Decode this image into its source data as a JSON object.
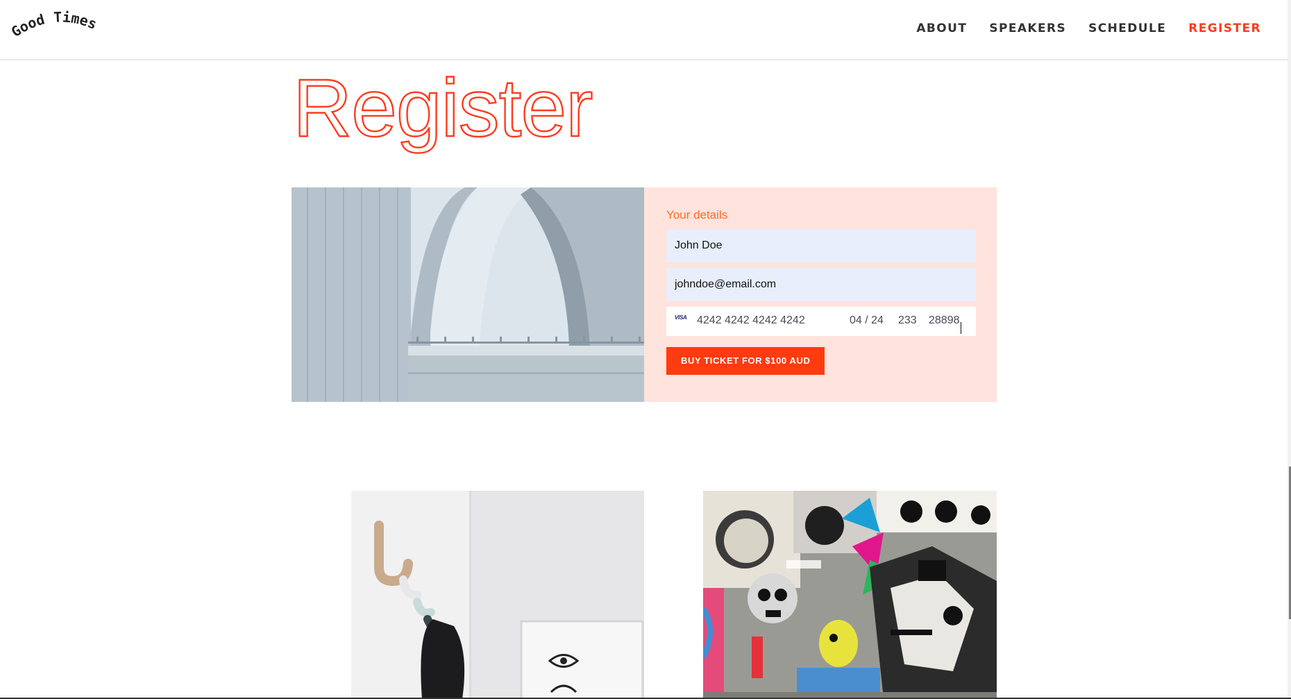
{
  "header": {
    "logo_text": "Good Times",
    "nav": [
      {
        "label": "ABOUT",
        "active": false
      },
      {
        "label": "SPEAKERS",
        "active": false
      },
      {
        "label": "SCHEDULE",
        "active": false
      },
      {
        "label": "REGISTER",
        "active": true
      }
    ]
  },
  "page": {
    "title": "Register"
  },
  "register": {
    "heading": "Your details",
    "name_value": "John Doe",
    "email_value": "johndoe@email.com",
    "card": {
      "brand_icon": "visa-icon",
      "brand_label": "VISA",
      "number": "4242 4242 4242 4242",
      "expiry": "04 / 24",
      "cvc": "233",
      "postcode": "28898"
    },
    "button_label": "BUY TICKET FOR $100 AUD"
  },
  "colors": {
    "accent": "#ff3b1f",
    "card_background": "#ffe3dc",
    "input_background": "#e8eefb",
    "heading_orange": "#ff6a2a"
  }
}
